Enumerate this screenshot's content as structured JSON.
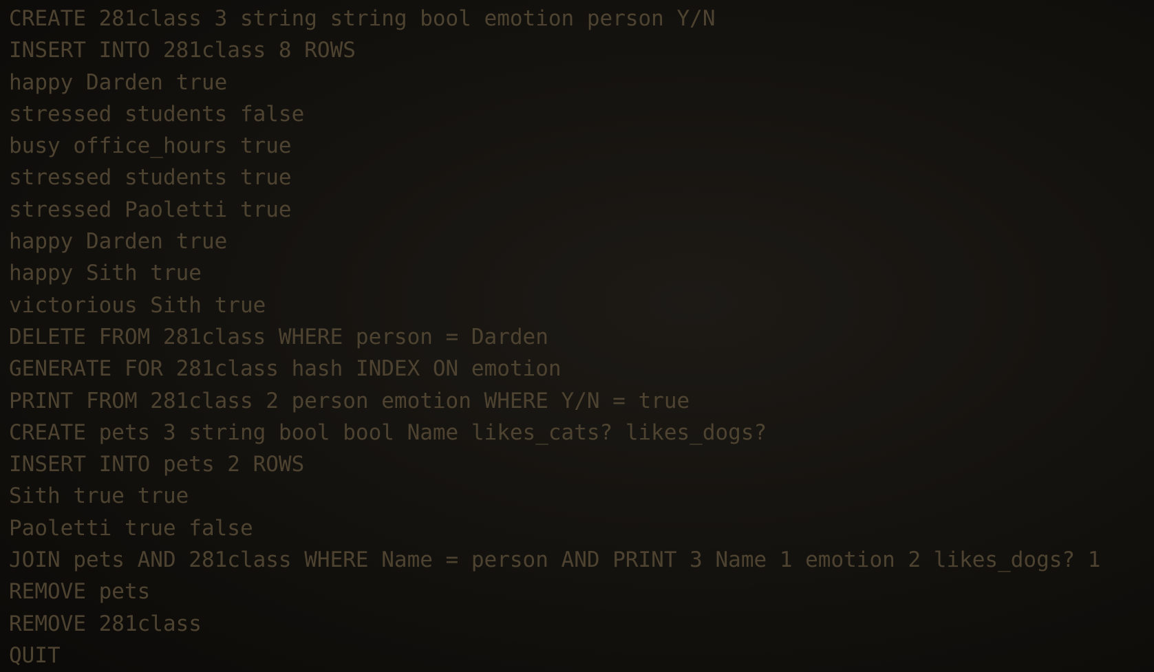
{
  "terminal": {
    "text_color": "#4e4330",
    "background_color": "#141210",
    "lines": [
      "CREATE 281class 3 string string bool emotion person Y/N",
      "INSERT INTO 281class 8 ROWS",
      "happy Darden true",
      "stressed students false",
      "busy office_hours true",
      "stressed students true",
      "stressed Paoletti true",
      "happy Darden true",
      "happy Sith true",
      "victorious Sith true",
      "DELETE FROM 281class WHERE person = Darden",
      "GENERATE FOR 281class hash INDEX ON emotion",
      "PRINT FROM 281class 2 person emotion WHERE Y/N = true",
      "CREATE pets 3 string bool bool Name likes_cats? likes_dogs?",
      "INSERT INTO pets 2 ROWS",
      "Sith true true",
      "Paoletti true false",
      "JOIN pets AND 281class WHERE Name = person AND PRINT 3 Name 1 emotion 2 likes_dogs? 1",
      "REMOVE pets",
      "REMOVE 281class",
      "QUIT"
    ]
  }
}
